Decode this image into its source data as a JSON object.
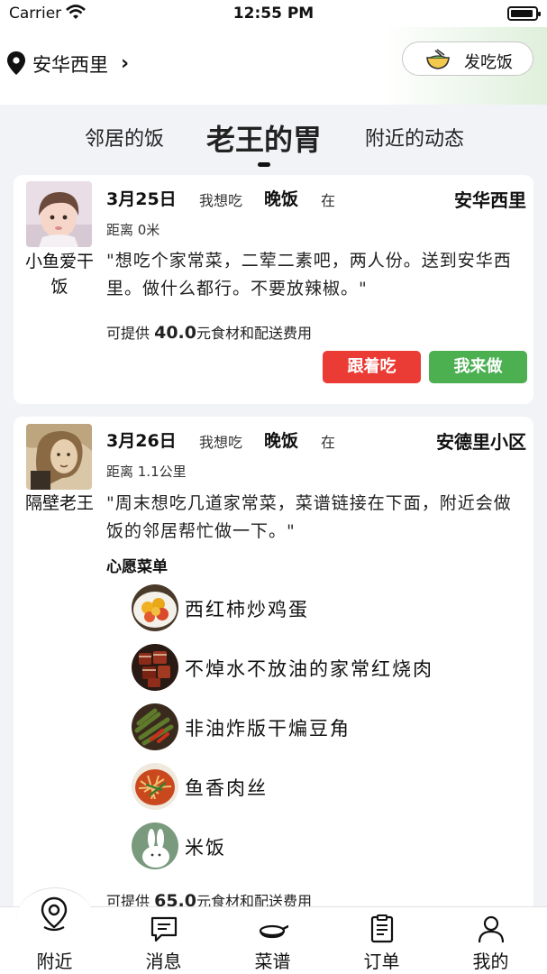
{
  "status_bar": {
    "carrier": "Carrier",
    "time": "12:55 PM"
  },
  "header": {
    "location": "安华西里",
    "post_button": "发吃饭"
  },
  "tabs": [
    {
      "label": "邻居的饭"
    },
    {
      "label": "老王的胃"
    },
    {
      "label": "附近的动态"
    }
  ],
  "posts": [
    {
      "nickname": "小鱼爱干饭",
      "date": "3月25日",
      "want": "我想吃",
      "meal": "晚饭",
      "at": "在",
      "place": "安华西里",
      "distance": "距离 0米",
      "quote": "\"想吃个家常菜，二荤二素吧，两人份。送到安华西里。做什么都行。不要放辣椒。\"",
      "offer_prefix": "可提供 ",
      "offer_amount": "40.0",
      "offer_suffix": "元食材和配送费用",
      "follow_button": "跟着吃",
      "cook_button": "我来做"
    },
    {
      "nickname": "隔壁老王",
      "date": "3月26日",
      "want": "我想吃",
      "meal": "晚饭",
      "at": "在",
      "place": "安德里小区",
      "distance": "距离 1.1公里",
      "quote": "\"周末想吃几道家常菜，菜谱链接在下面，附近会做饭的邻居帮忙做一下。\"",
      "wish_title": "心愿菜单",
      "dishes": [
        {
          "name": "西红柿炒鸡蛋"
        },
        {
          "name": "不焯水不放油的家常红烧肉"
        },
        {
          "name": "非油炸版干煸豆角"
        },
        {
          "name": "鱼香肉丝"
        },
        {
          "name": "米饭"
        }
      ],
      "offer_prefix": "可提供 ",
      "offer_amount": "65.0",
      "offer_suffix": "元食材和配送费用"
    }
  ],
  "bottom_nav": [
    {
      "label": "附近",
      "icon": "location-pin-icon"
    },
    {
      "label": "消息",
      "icon": "message-icon"
    },
    {
      "label": "菜谱",
      "icon": "pan-icon"
    },
    {
      "label": "订单",
      "icon": "clipboard-icon"
    },
    {
      "label": "我的",
      "icon": "user-icon"
    }
  ],
  "colors": {
    "accent_red": "#ea3b34",
    "accent_green": "#4caf50"
  }
}
